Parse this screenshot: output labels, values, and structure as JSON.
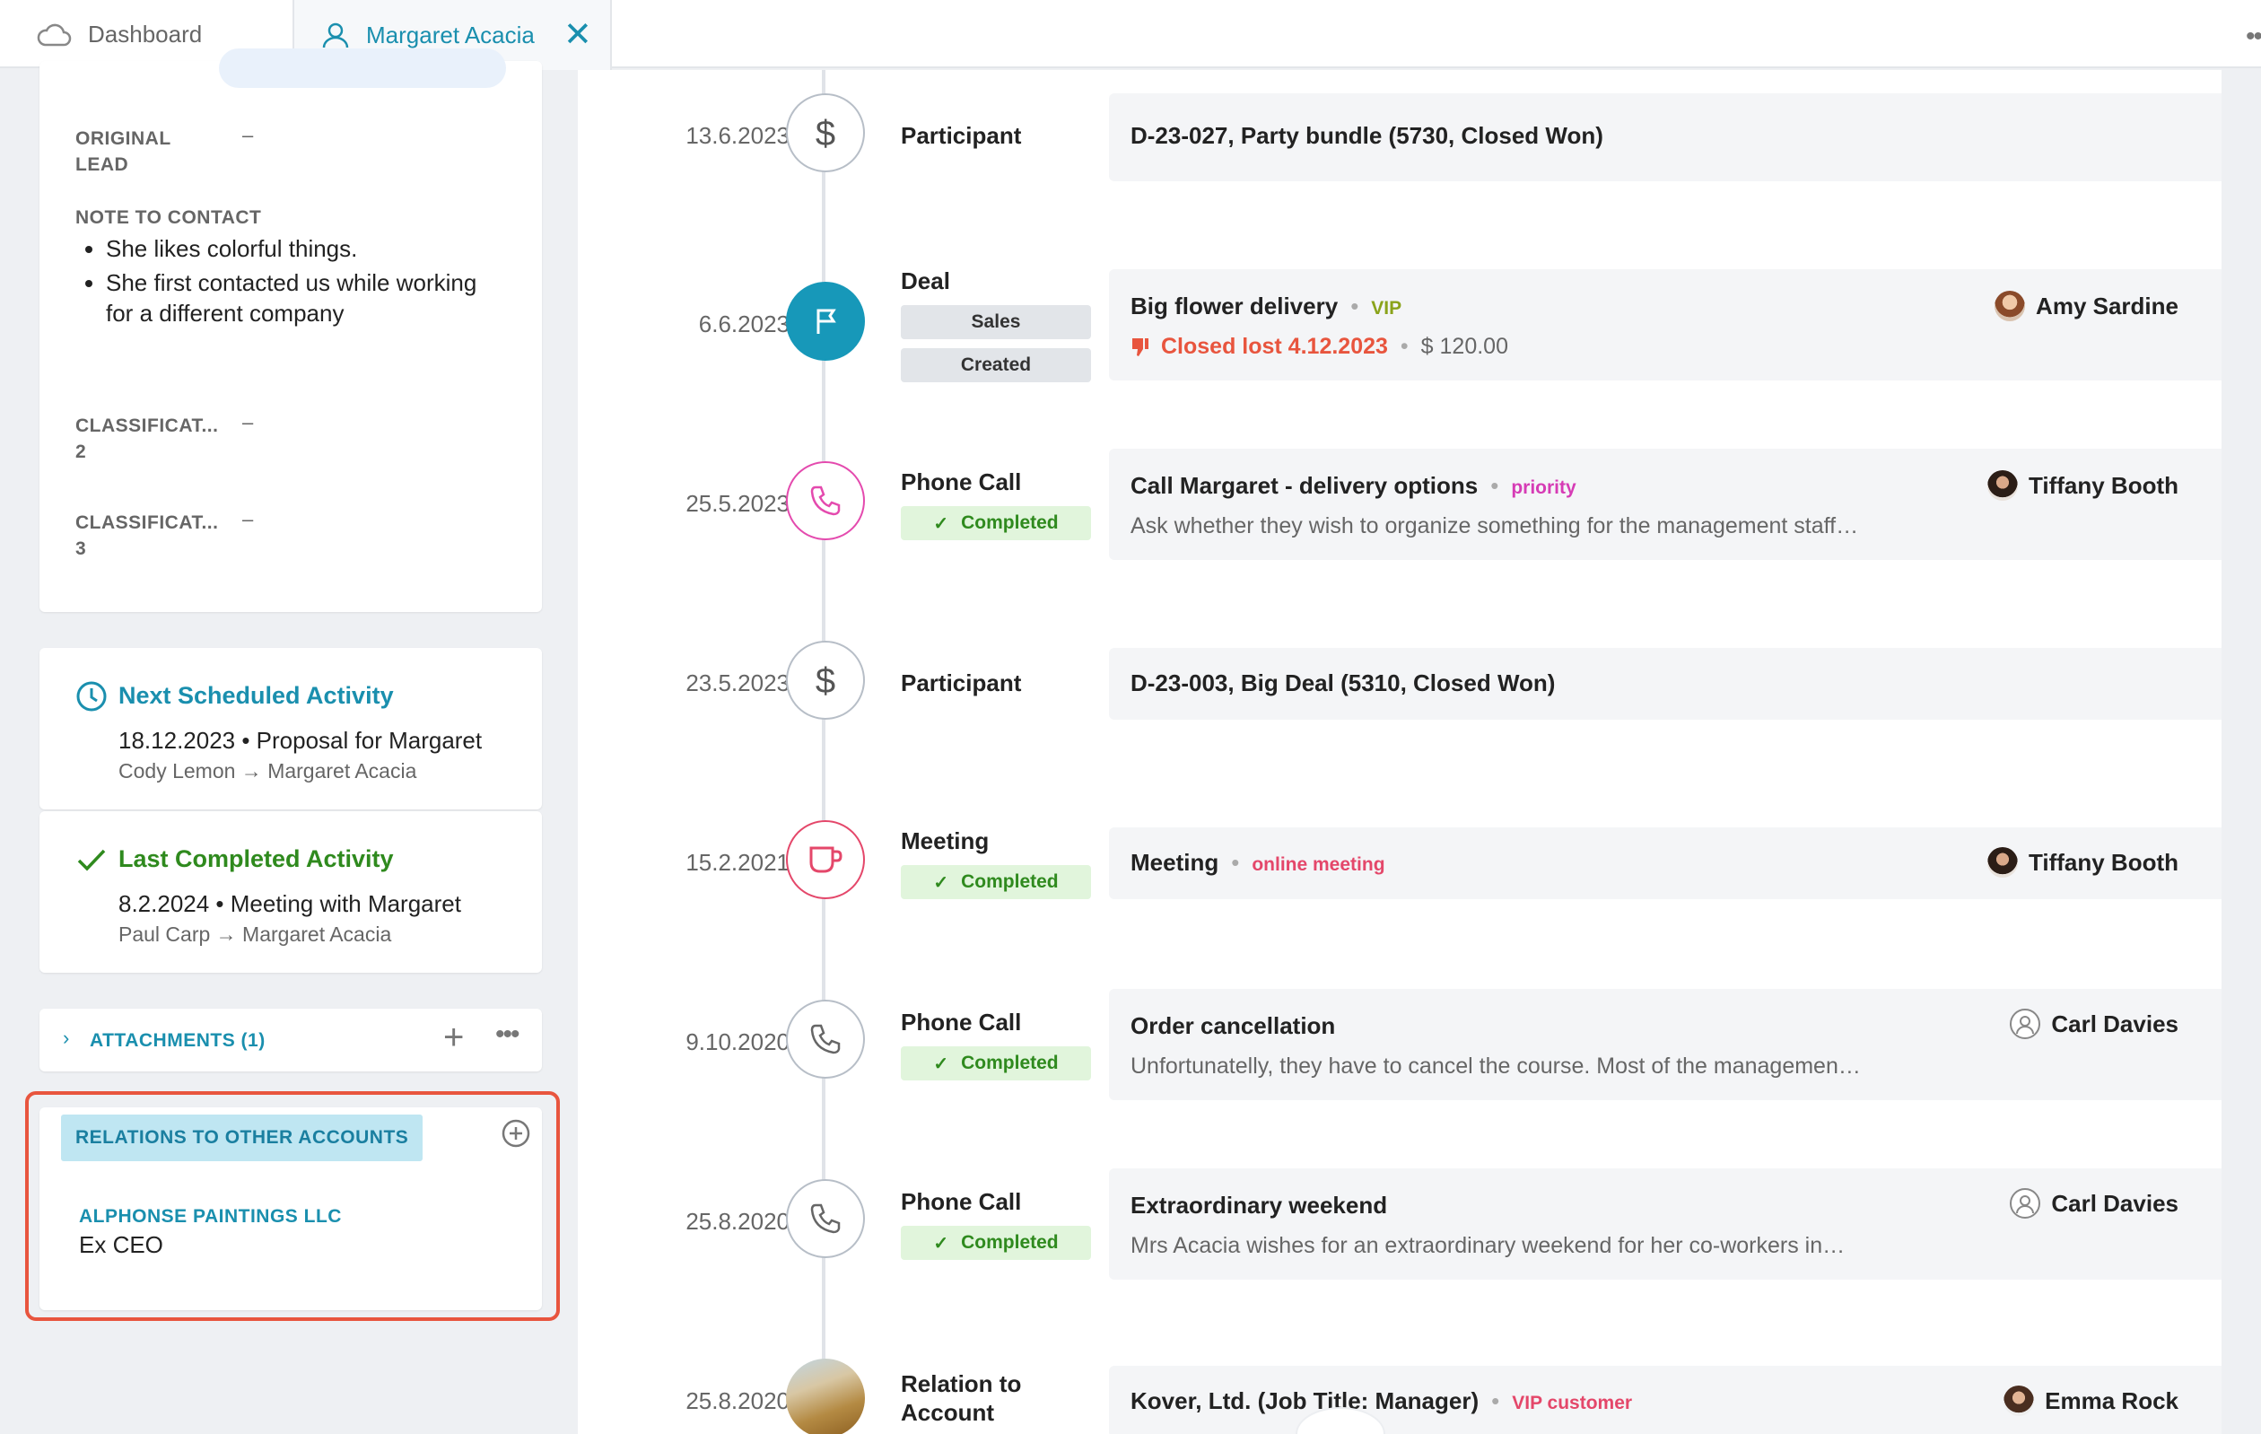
{
  "tabs": {
    "dashboard_label": "Dashboard",
    "contact_label": "Margaret Acacia"
  },
  "info_card": {
    "original_lead_label": "ORIGINAL LEAD",
    "original_lead_value": "–",
    "note_label": "NOTE TO CONTACT",
    "notes": [
      "She likes colorful things.",
      "She first contacted us while working for a different company"
    ],
    "classification2_label": "CLASSIFICAT...",
    "classification2_num": "2",
    "classification2_value": "–",
    "classification3_label": "CLASSIFICAT...",
    "classification3_num": "3",
    "classification3_value": "–"
  },
  "next_activity": {
    "title": "Next Scheduled Activity",
    "line1": "18.12.2023 • Proposal for Margaret",
    "line2": "Cody Lemon → Margaret Acacia"
  },
  "last_activity": {
    "title": "Last Completed Activity",
    "line1": "8.2.2024 • Meeting with Margaret",
    "line2": "Paul Carp → Margaret Acacia"
  },
  "attachments": {
    "label": "ATTACHMENTS (1)"
  },
  "relations": {
    "header": "RELATIONS TO OTHER ACCOUNTS",
    "company": "ALPHONSE PAINTINGS LLC",
    "role": "Ex CEO"
  },
  "timeline": [
    {
      "date": "13.6.2023",
      "type": "Participant",
      "title": "D-23-027, Party bundle (5730, Closed Won)"
    },
    {
      "date": "6.6.2023",
      "type": "Deal",
      "badge1": "Sales",
      "badge2": "Created",
      "title": "Big flower delivery",
      "tag": "VIP",
      "status": "Closed lost 4.12.2023",
      "amount": "$ 120.00",
      "owner": "Amy Sardine"
    },
    {
      "date": "25.5.2023",
      "type": "Phone Call",
      "badge": "Completed",
      "title": "Call Margaret - delivery options",
      "tag": "priority",
      "sub": "Ask whether they wish to organize something for the management staff…",
      "owner": "Tiffany Booth"
    },
    {
      "date": "23.5.2023",
      "type": "Participant",
      "title": "D-23-003, Big Deal (5310, Closed Won)"
    },
    {
      "date": "15.2.2021",
      "type": "Meeting",
      "badge": "Completed",
      "title": "Meeting",
      "tag": "online meeting",
      "owner": "Tiffany Booth"
    },
    {
      "date": "9.10.2020",
      "type": "Phone Call",
      "badge": "Completed",
      "title": "Order cancellation",
      "sub": "Unfortunatelly, they have to cancel the course. Most of the managemen…",
      "owner": "Carl Davies"
    },
    {
      "date": "25.8.2020",
      "type": "Phone Call",
      "badge": "Completed",
      "title": "Extraordinary weekend",
      "sub": "Mrs Acacia wishes for an extraordinary weekend for her co-workers in…",
      "owner": "Carl Davies"
    },
    {
      "date": "25.8.2020",
      "type": "Relation to Account",
      "title": "Kover, Ltd. (Job Title: Manager)",
      "tag": "VIP customer",
      "owner": "Emma Rock"
    }
  ],
  "colors": {
    "accent": "#1a8fae",
    "success": "#2f8a1e",
    "danger": "#e8553e",
    "vip": "#8aa31a",
    "priority": "#d63bb5",
    "online": "#e4476a"
  },
  "icons": [
    "cloud-icon",
    "user-icon",
    "close-icon",
    "more-icon",
    "clock-icon",
    "check-icon",
    "chevron-right-icon",
    "plus-icon",
    "add-circle-icon",
    "dollar-icon",
    "flag-icon",
    "phone-icon",
    "cup-icon",
    "thumbs-down-icon"
  ]
}
